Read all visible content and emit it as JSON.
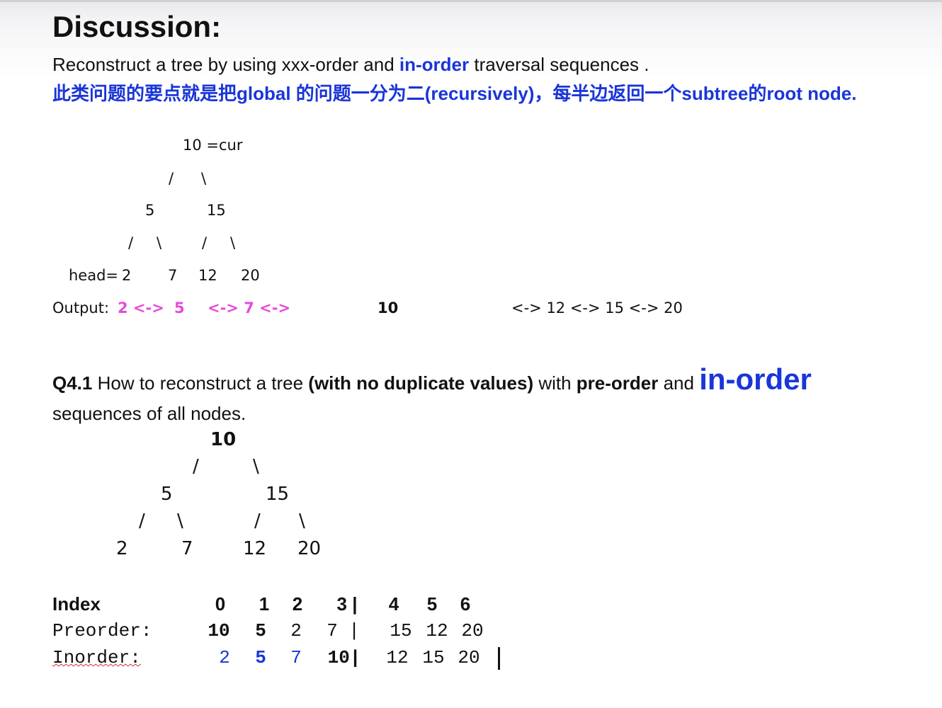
{
  "heading": "Discussion:",
  "intro": {
    "prefix": "Reconstruct a tree by using  xxx-order and ",
    "highlight": "in-order",
    "suffix": " traversal sequences ."
  },
  "note_cn": "此类问题的要点就是把global 的问题一分为二(recursively)，每半边返回一个subtree的root node.",
  "tree1": {
    "root": "10 =cur",
    "l1_edges": [
      "/",
      "\\"
    ],
    "l1": [
      "5",
      "15"
    ],
    "l2_edges": [
      "/",
      "\\",
      "/",
      "\\"
    ],
    "head_label": "head=",
    "l2": [
      "2",
      "7",
      "12",
      "20"
    ]
  },
  "output": {
    "label": "Output:",
    "p1": "2 <->",
    "p2": "5",
    "p3": "<-> 7 <->",
    "p4": "10",
    "p5": "<-> 12 <->  15 <->  20"
  },
  "q41": {
    "num": "Q4.1",
    "t1": " How to reconstruct a tree ",
    "t2": "(with no duplicate values)",
    "t3": " with ",
    "t4": "pre-order",
    "t5": " and ",
    "t6": "in-order",
    "line2": "sequences of all nodes."
  },
  "tree2": {
    "root": "10",
    "l1_edges": [
      "/",
      "\\"
    ],
    "l1": [
      "5",
      "15"
    ],
    "l2_edges": [
      "/",
      "\\",
      "/",
      "\\"
    ],
    "l2": [
      "2",
      "7",
      "12",
      "20"
    ]
  },
  "table": {
    "index_label": "Index",
    "index": [
      "0",
      "1",
      "2",
      "3 |",
      "4",
      "5",
      "6"
    ],
    "pre_label": "Preorder:",
    "pre": [
      "10",
      "5",
      "2",
      "7",
      "|",
      "15",
      "12",
      "20"
    ],
    "in_label": "Inorder:",
    "in": [
      "2",
      "5",
      "7",
      "10|",
      "12",
      "15",
      "20"
    ]
  },
  "colors": {
    "accent_blue": "#1a35d8",
    "pink": "#e64bd8"
  }
}
